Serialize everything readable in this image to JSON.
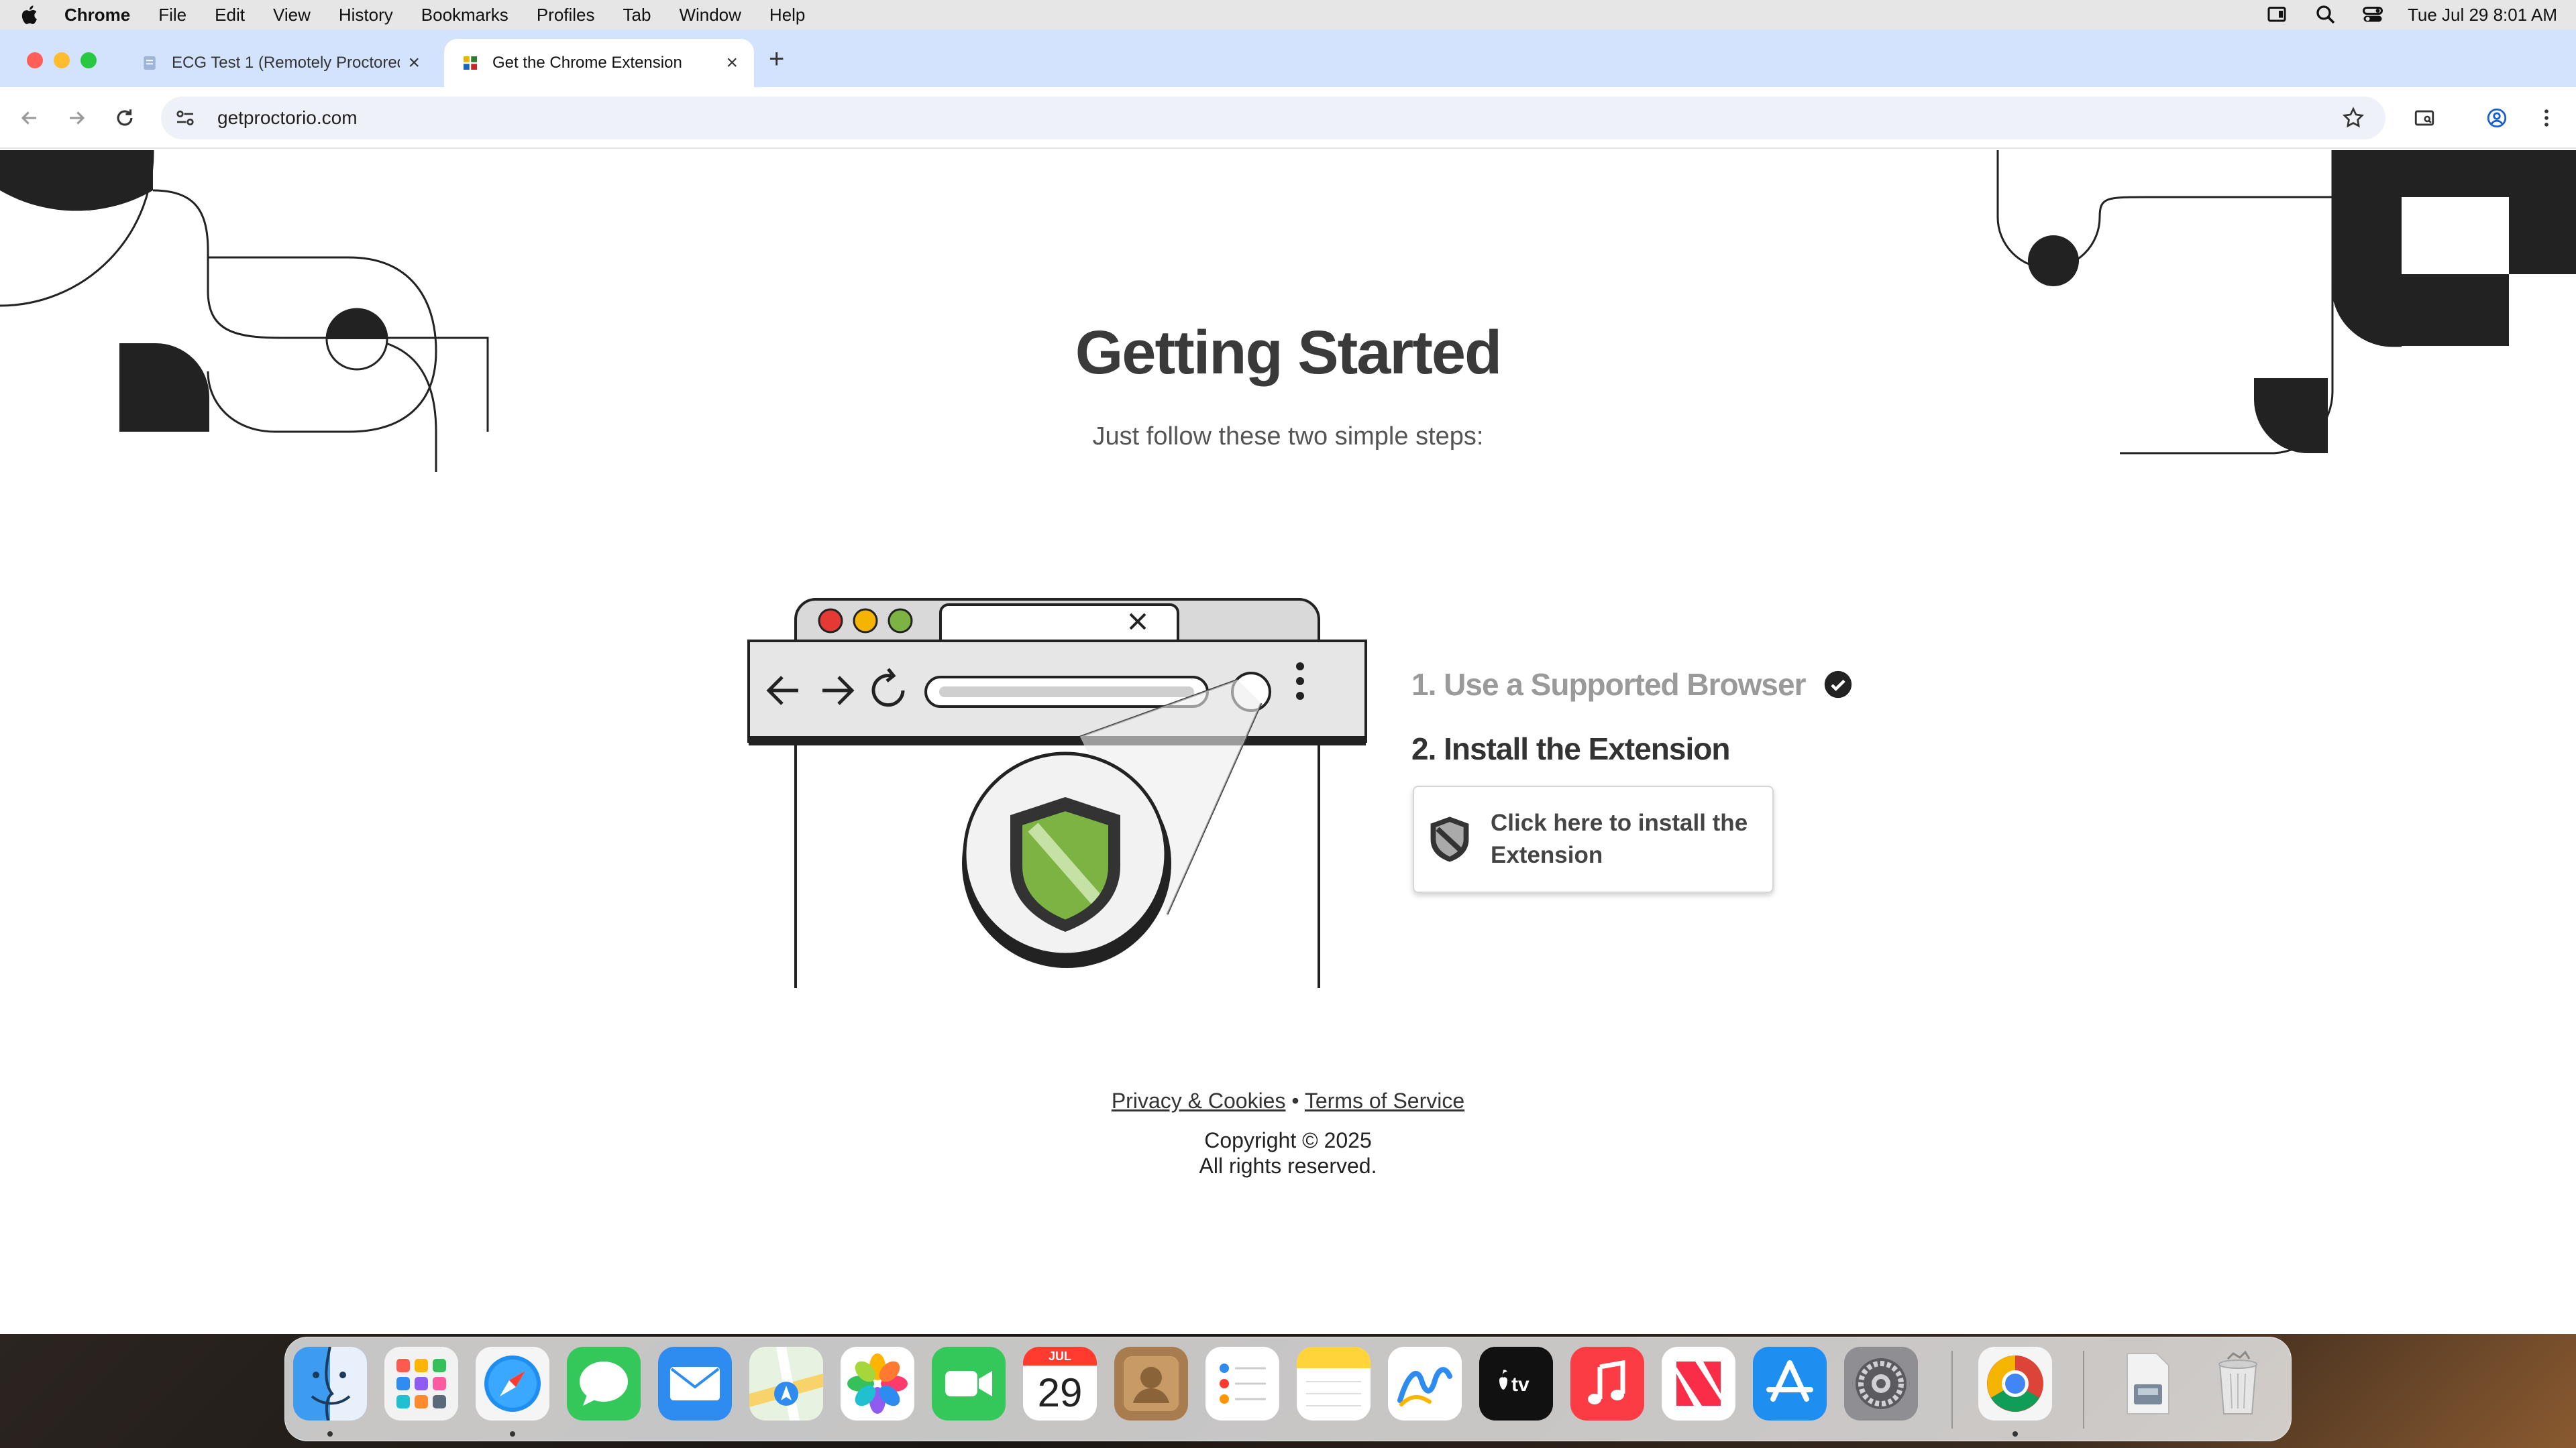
{
  "menubar": {
    "app_name": "Chrome",
    "menus": [
      "File",
      "Edit",
      "View",
      "History",
      "Bookmarks",
      "Profiles",
      "Tab",
      "Window",
      "Help"
    ],
    "clock": "Tue Jul 29  8:01 AM"
  },
  "browser": {
    "tabs": [
      {
        "title": "ECG Test 1 (Remotely Proctored)",
        "active": false
      },
      {
        "title": "Get the Chrome Extension",
        "active": true
      }
    ],
    "url": "getproctorio.com"
  },
  "page": {
    "title": "Getting Started",
    "subtitle": "Just follow these two simple steps:",
    "step1": "1. Use a Supported Browser",
    "step2": "2. Install the Extension",
    "install_button": "Click here to install the Extension",
    "footer": {
      "privacy": "Privacy & Cookies",
      "separator": "•",
      "terms": "Terms of Service",
      "copyright": "Copyright © 2025",
      "rights": "All rights reserved."
    }
  },
  "dock": {
    "calendar_month": "JUL",
    "calendar_day": "29",
    "apps": [
      "Finder",
      "Launchpad",
      "Safari",
      "Messages",
      "Mail",
      "Maps",
      "Photos",
      "FaceTime",
      "Calendar",
      "Contacts",
      "Reminders",
      "Notes",
      "Freeform",
      "TV",
      "Music",
      "News",
      "App Store",
      "System Settings",
      "Chrome",
      "Downloads",
      "Trash"
    ]
  },
  "colors": {
    "tabstrip": "#d3e3fd",
    "shield_green": "#7cb342",
    "dark": "#222222"
  }
}
